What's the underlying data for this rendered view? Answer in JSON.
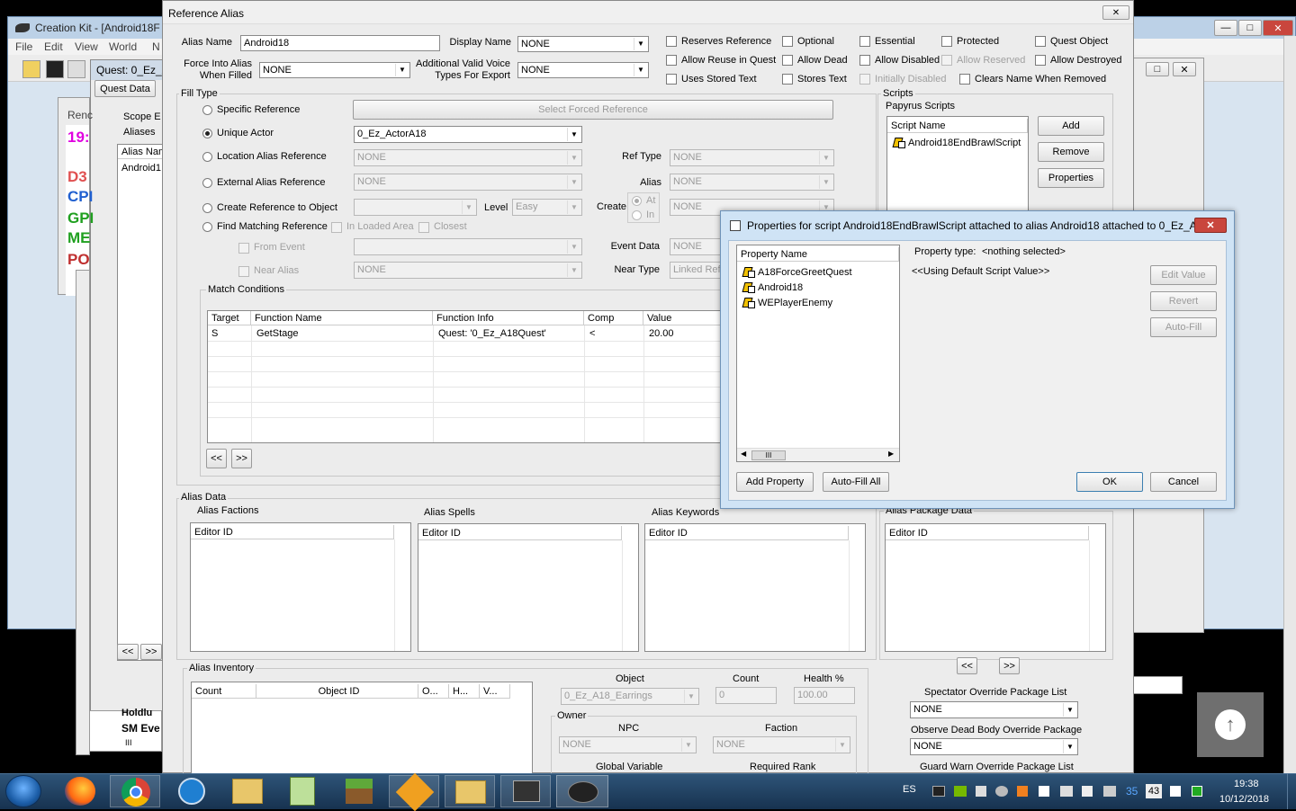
{
  "main_window": {
    "title": "Creation Kit - [Android18F",
    "menu": [
      "File",
      "Edit",
      "View",
      "World",
      "N"
    ],
    "toolbar": [
      "open-icon",
      "save-icon",
      "properties-icon"
    ]
  },
  "quest_window": {
    "title": "Quest: 0_Ez_A",
    "tab_quest_data": "Quest Data",
    "ren_label": "Renc",
    "scope_label": "Scope E",
    "aliases_label": "Aliases",
    "alias_name_header": "Alias Nam",
    "alias_row": "Android1",
    "nav_prev": "<<",
    "nav_next": ">>",
    "left_list_items": [
      "19:",
      "D3",
      "CPI",
      "GPI",
      "ME",
      "PO"
    ],
    "left_list_colors": [
      "#e000e0",
      "#e03030",
      "#2060d0",
      "#20a020",
      "#20a020",
      "#c03030"
    ],
    "bottom_rows": [
      "Holdlu",
      "SM Eve"
    ]
  },
  "reference_alias": {
    "title": "Reference Alias",
    "alias_name_label": "Alias Name",
    "alias_name_value": "Android18",
    "display_name_label": "Display Name",
    "display_name_value": "NONE",
    "force_into_label_1": "Force Into Alias",
    "force_into_label_2": "When Filled",
    "force_into_value": "NONE",
    "voice_label_1": "Additional Valid Voice",
    "voice_label_2": "Types For Export",
    "voice_value": "NONE",
    "checkboxes": [
      {
        "label": "Reserves Reference",
        "disabled": false
      },
      {
        "label": "Optional",
        "disabled": false
      },
      {
        "label": "Essential",
        "disabled": false
      },
      {
        "label": "Protected",
        "disabled": false
      },
      {
        "label": "Quest Object",
        "disabled": false
      },
      {
        "label": "Allow Reuse in Quest",
        "disabled": false
      },
      {
        "label": "Allow Dead",
        "disabled": false
      },
      {
        "label": "Allow Disabled",
        "disabled": false
      },
      {
        "label": "Allow Reserved",
        "disabled": true
      },
      {
        "label": "Allow Destroyed",
        "disabled": false
      },
      {
        "label": "Uses Stored Text",
        "disabled": false
      },
      {
        "label": "Stores Text",
        "disabled": false
      },
      {
        "label": "Initially Disabled",
        "disabled": true
      },
      {
        "label": "Clears Name When Removed",
        "disabled": false
      }
    ],
    "fill_type": {
      "group_label": "Fill Type",
      "specific_reference": "Specific Reference",
      "select_forced_reference": "Select Forced Reference",
      "unique_actor": "Unique Actor",
      "unique_actor_value": "0_Ez_ActorA18",
      "location_alias_reference": "Location Alias Reference",
      "location_alias_value": "NONE",
      "ref_type_label": "Ref Type",
      "ref_type_value": "NONE",
      "external_alias_reference": "External Alias Reference",
      "external_alias_value": "NONE",
      "alias_label": "Alias",
      "alias_value": "NONE",
      "create_reference": "Create Reference to Object",
      "create_value": "",
      "level_label": "Level",
      "level_value": "Easy",
      "create_label": "Create",
      "at_label": "At",
      "in_label": "In",
      "create_alias_value": "NONE",
      "find_matching": "Find Matching Reference",
      "in_loaded_area": "In Loaded Area",
      "closest": "Closest",
      "from_event": "From Event",
      "from_event_value": "",
      "event_data_label": "Event Data",
      "event_data_value": "NONE",
      "near_alias": "Near Alias",
      "near_alias_value": "NONE",
      "near_type_label": "Near Type",
      "near_type_value": "Linked Ref"
    },
    "match_conditions": {
      "label": "Match Conditions",
      "headers": [
        "Target",
        "Function Name",
        "Function Info",
        "Comp",
        "Value"
      ],
      "rows": [
        [
          "S",
          "GetStage",
          "Quest: '0_Ez_A18Quest'",
          "<",
          "20.00"
        ]
      ],
      "nav_prev": "<<",
      "nav_next": ">>"
    },
    "scripts": {
      "group_label": "Scripts",
      "papyrus_label": "Papyrus Scripts",
      "header": "Script Name",
      "items": [
        "Android18EndBrawlScript"
      ],
      "add": "Add",
      "remove": "Remove",
      "properties": "Properties"
    },
    "alias_data": {
      "label": "Alias Data",
      "factions_label": "Alias Factions",
      "spells_label": "Alias Spells",
      "keywords_label": "Alias Keywords",
      "package_label": "Alias Package Data",
      "editor_id": "Editor ID",
      "nav_prev": "<<",
      "nav_next": ">>"
    },
    "inventory": {
      "label": "Alias Inventory",
      "headers": [
        "Count",
        "Object ID",
        "O...",
        "H...",
        "V..."
      ],
      "object_label": "Object",
      "object_value": "0_Ez_A18_Earrings",
      "count_label": "Count",
      "count_value": "0",
      "health_label": "Health %",
      "health_value": "100.00",
      "owner_label": "Owner",
      "npc_label": "NPC",
      "npc_value": "NONE",
      "faction_label": "Faction",
      "faction_value": "NONE",
      "global_variable_label": "Global Variable",
      "required_rank_label": "Required Rank"
    },
    "overrides": {
      "spectator_label": "Spectator Override Package List",
      "spectator_value": "NONE",
      "observe_label": "Observe Dead Body Override Package",
      "observe_value": "NONE",
      "guard_label": "Guard Warn Override Package List"
    }
  },
  "properties_dialog": {
    "title": "Properties for script Android18EndBrawlScript attached to alias Android18 attached to 0_Ez_A...",
    "header": "Property Name",
    "items": [
      "A18ForceGreetQuest",
      "Android18",
      "WEPlayerEnemy"
    ],
    "property_type_label": "Property type:",
    "property_type_value": "<nothing selected>",
    "default_value": "<<Using Default Script Value>>",
    "edit_value": "Edit Value",
    "revert": "Revert",
    "auto_fill": "Auto-Fill",
    "add_property": "Add Property",
    "auto_fill_all": "Auto-Fill All",
    "ok": "OK",
    "cancel": "Cancel",
    "scroll_thumb": "III"
  },
  "taskbar": {
    "apps": [
      "start-orb-icon",
      "firefox-icon",
      "chrome-icon",
      "activity-monitor-icon",
      "file-explorer-icon",
      "notepad-plus-icon",
      "minecraft-icon",
      "puzzle-app-icon",
      "folder-icon",
      "terminal-icon",
      "creation-kit-icon"
    ],
    "language": "ES",
    "tray_number": "43",
    "tray_blue_number": "35",
    "time": "19:38",
    "date": "10/12/2018"
  },
  "colors": {
    "taskbar": "#1b3a5c",
    "dialog_title_active": "#cfe3f5",
    "close_red": "#c9463d",
    "window_bg": "#ececec"
  }
}
